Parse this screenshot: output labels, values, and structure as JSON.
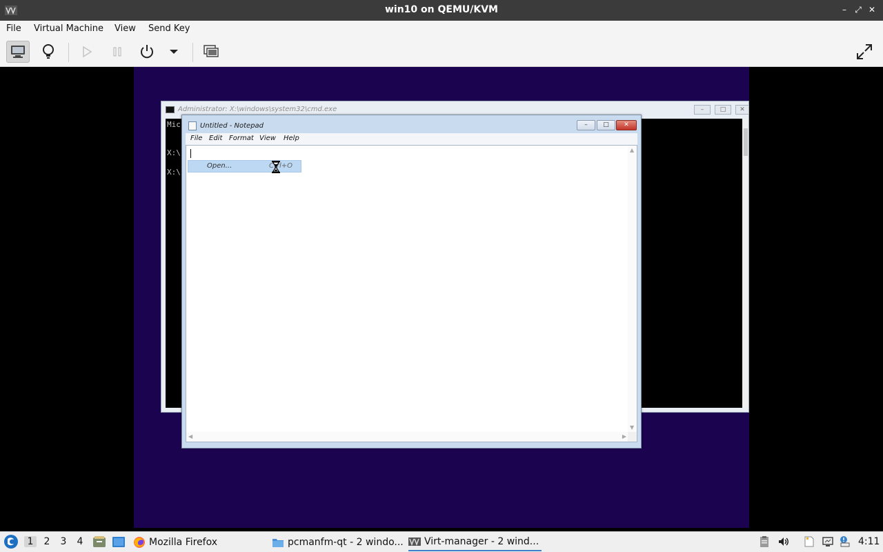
{
  "window": {
    "title": "win10 on QEMU/KVM",
    "controls": [
      "–",
      "⤢",
      "✕"
    ]
  },
  "menubar": {
    "items": [
      "File",
      "Virtual Machine",
      "View",
      "Send Key"
    ]
  },
  "toolbar": {
    "icons": [
      "console-icon",
      "details-lightbulb-icon",
      "run-icon",
      "pause-icon",
      "power-icon",
      "power-dropdown-icon",
      "snapshots-icon",
      "fullscreen-icon"
    ]
  },
  "guest": {
    "cmd": {
      "title": "Administrator: X:\\windows\\system32\\cmd.exe",
      "lines": [
        "Mic",
        "X:\\",
        "X:\\"
      ]
    },
    "notepad": {
      "title": "Untitled - Notepad",
      "menu": [
        "File",
        "Edit",
        "Format",
        "View",
        "Help"
      ],
      "open_item": {
        "label": "Open...",
        "shortcut": "Ctrl+O"
      }
    }
  },
  "taskbar": {
    "workspaces": [
      "1",
      "2",
      "3",
      "4"
    ],
    "tasks": [
      {
        "label": "Mozilla Firefox",
        "icon": "firefox-icon"
      },
      {
        "label": "pcmanfm-qt - 2 windo...",
        "icon": "folder-icon"
      },
      {
        "label": "Virt-manager - 2 wind...",
        "icon": "virt-manager-icon"
      }
    ],
    "clock": "4:11"
  },
  "colors": {
    "vm_background": "#1c0350",
    "titlebar": "#3b3b3b",
    "accent": "#3a82c8"
  }
}
